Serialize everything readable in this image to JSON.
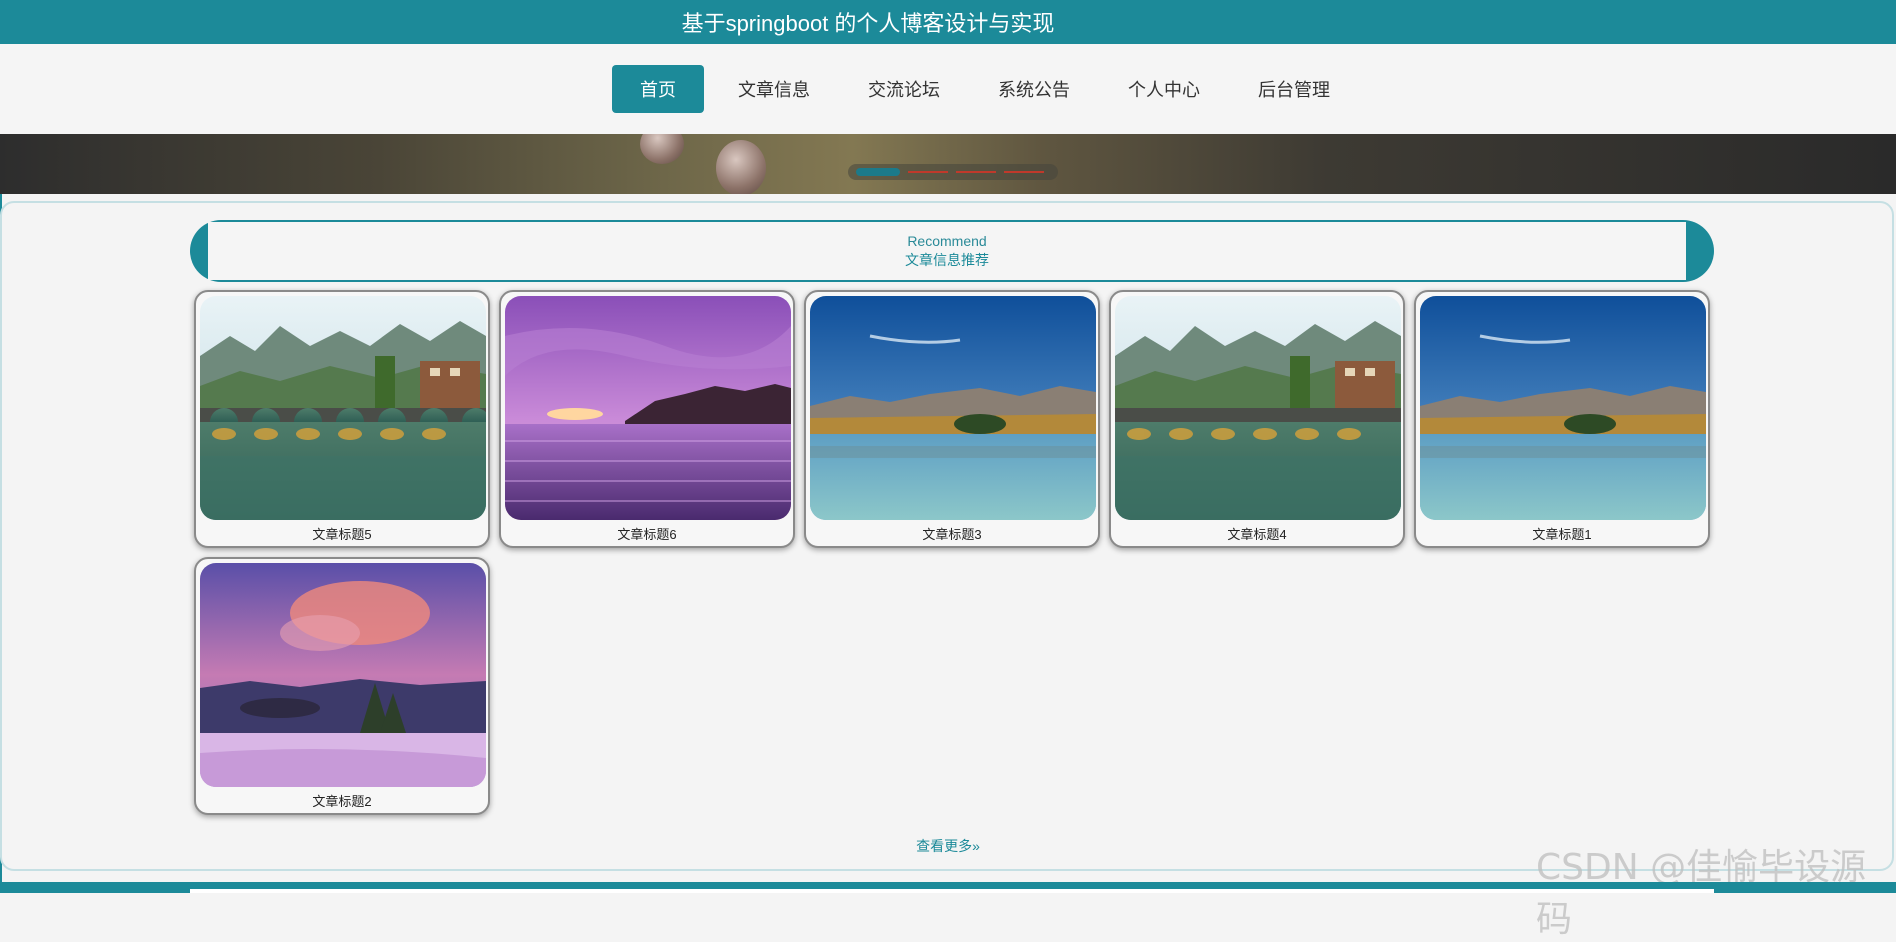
{
  "site": {
    "title": "基于springboot 的个人博客设计与实现"
  },
  "nav": {
    "items": [
      {
        "label": "首页",
        "active": true
      },
      {
        "label": "文章信息",
        "active": false
      },
      {
        "label": "交流论坛",
        "active": false
      },
      {
        "label": "系统公告",
        "active": false
      },
      {
        "label": "个人中心",
        "active": false
      },
      {
        "label": "后台管理",
        "active": false
      }
    ]
  },
  "carousel": {
    "slide_count": 4,
    "active_index": 0
  },
  "section": {
    "title_en": "Recommend",
    "title_cn": "文章信息推荐"
  },
  "articles": [
    {
      "title": "文章标题5",
      "image": "bridge-river-landscape"
    },
    {
      "title": "文章标题6",
      "image": "purple-sea-sunset"
    },
    {
      "title": "文章标题3",
      "image": "mountain-lake-reflection"
    },
    {
      "title": "文章标题4",
      "image": "bridge-river-landscape"
    },
    {
      "title": "文章标题1",
      "image": "mountain-lake-reflection"
    },
    {
      "title": "文章标题2",
      "image": "crater-lake-pink-sky"
    }
  ],
  "more": {
    "label": "查看更多",
    "icon": "double-chevron-right-icon"
  },
  "watermark": "CSDN @佳愉毕设源码",
  "colors": {
    "primary": "#1c8a99",
    "background": "#f4f4f4"
  }
}
